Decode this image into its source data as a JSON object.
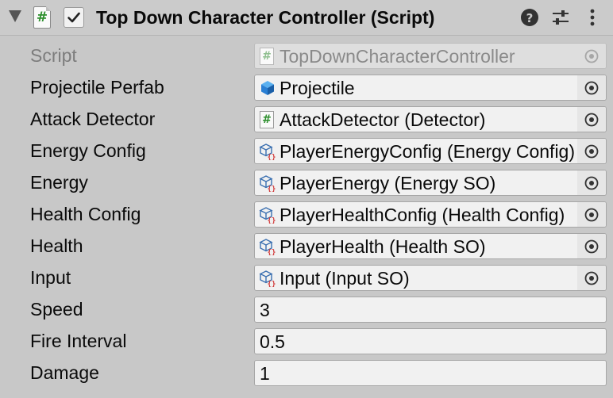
{
  "header": {
    "title": "Top Down Character Controller (Script)",
    "enabled": true
  },
  "fields": [
    {
      "label": "Script",
      "kind": "object",
      "value": "TopDownCharacterController",
      "icon": "script-icon",
      "disabled": true
    },
    {
      "label": "Projectile Perfab",
      "kind": "object",
      "value": "Projectile",
      "icon": "prefab-cube-icon",
      "disabled": false
    },
    {
      "label": "Attack Detector",
      "kind": "object",
      "value": "AttackDetector (Detector)",
      "icon": "script-icon",
      "disabled": false
    },
    {
      "label": "Energy Config",
      "kind": "object",
      "value": "PlayerEnergyConfig (Energy Config)",
      "icon": "scriptable-object-icon",
      "disabled": false
    },
    {
      "label": "Energy",
      "kind": "object",
      "value": "PlayerEnergy (Energy SO)",
      "icon": "scriptable-object-icon",
      "disabled": false
    },
    {
      "label": "Health Config",
      "kind": "object",
      "value": "PlayerHealthConfig (Health Config)",
      "icon": "scriptable-object-icon",
      "disabled": false
    },
    {
      "label": "Health",
      "kind": "object",
      "value": "PlayerHealth (Health SO)",
      "icon": "scriptable-object-icon",
      "disabled": false
    },
    {
      "label": "Input",
      "kind": "object",
      "value": "Input (Input SO)",
      "icon": "scriptable-object-icon",
      "disabled": false
    },
    {
      "label": "Speed",
      "kind": "number",
      "value": "3"
    },
    {
      "label": "Fire Interval",
      "kind": "number",
      "value": "0.5"
    },
    {
      "label": "Damage",
      "kind": "number",
      "value": "1"
    }
  ],
  "colors": {
    "background": "#c8c8c8",
    "field_bg": "#f1f1f1",
    "script_hash": "#2d8f2d",
    "prefab_blue": "#2a7fd4",
    "so_red": "#d23c3c"
  }
}
